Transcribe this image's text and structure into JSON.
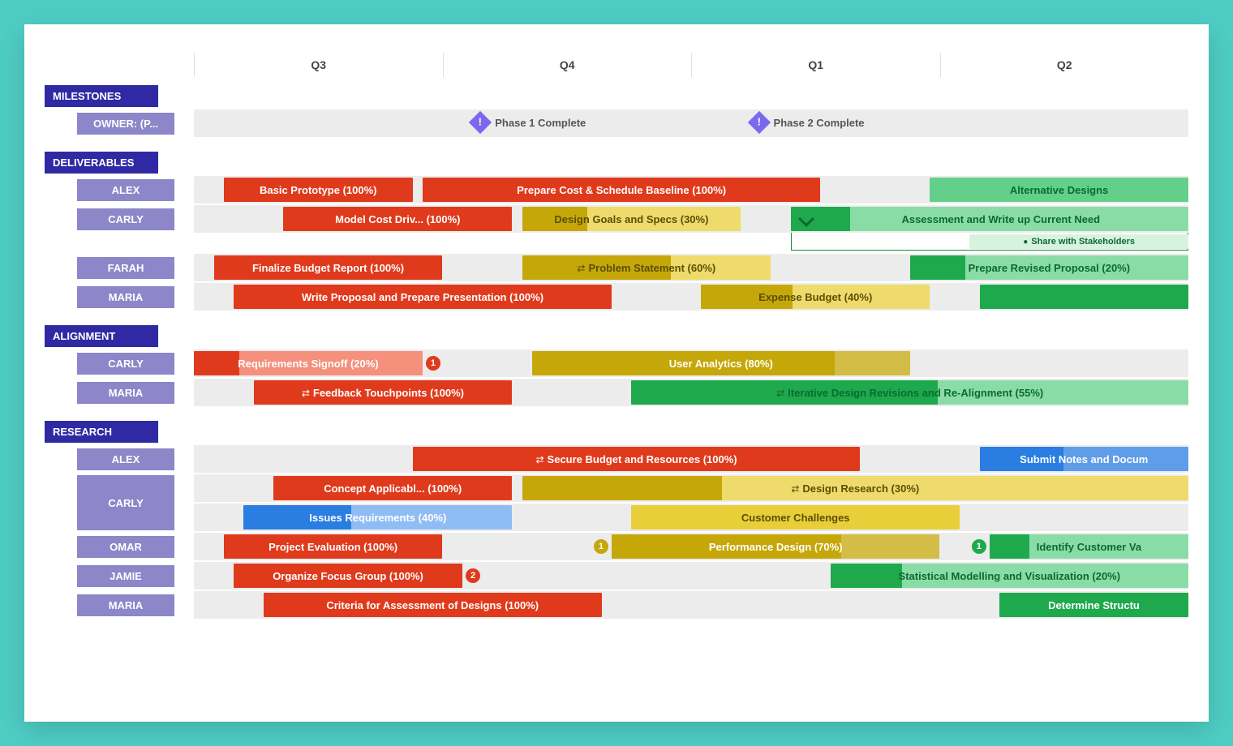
{
  "chart_data": {
    "type": "gantt",
    "time_axis": {
      "columns": [
        "Q3",
        "Q4",
        "Q1",
        "Q2"
      ],
      "unit": "quarter"
    },
    "colors": {
      "red": "#e03a1c",
      "red_light": "#f06b50",
      "olive": "#c5a709",
      "olive_light": "#e8cf3a",
      "green": "#1ea94c",
      "green_light": "#63d08a",
      "blue": "#2a7de1",
      "blue_light": "#6ba6f0",
      "section": "#2f2aa3",
      "owner": "#8d86c9",
      "milestone": "#7b68ee"
    },
    "sections": [
      {
        "name": "MILESTONES",
        "rows": [
          {
            "owner": "OWNER: (P...",
            "milestones": [
              {
                "label": "Phase 1 Complete",
                "pos": 28
              },
              {
                "label": "Phase 2 Complete",
                "pos": 56
              }
            ]
          }
        ]
      },
      {
        "name": "DELIVERABLES",
        "rows": [
          {
            "owner": "ALEX",
            "bars": [
              {
                "label": "Basic Prototype (100%)",
                "start": 3,
                "end": 22,
                "color": "red",
                "progress": 100
              },
              {
                "label": "Prepare Cost & Schedule Baseline (100%)",
                "start": 23,
                "end": 63,
                "color": "red",
                "progress": 100
              },
              {
                "label": "Alternative Designs",
                "start": 74,
                "end": 100,
                "color": "green_light",
                "text_color": "#0a6b2e",
                "progress": 0
              }
            ]
          },
          {
            "owner": "CARLY",
            "bars": [
              {
                "label": "Model Cost Driv... (100%)",
                "start": 9,
                "end": 32,
                "color": "red",
                "progress": 100
              },
              {
                "label": "Design Goals and Specs (30%)",
                "start": 33,
                "end": 55,
                "color": "olive_light",
                "progress": 30,
                "text_color": "#5c4f04"
              },
              {
                "label": "Assessment and Write up Current Need",
                "start": 60,
                "end": 100,
                "color": "green_light",
                "text_color": "#0a6b2e",
                "progress": 15,
                "expand": true,
                "subtasks": [
                  {
                    "label": "Share with Stakeholders",
                    "start": 78,
                    "end": 100
                  }
                ]
              }
            ]
          },
          {
            "owner": "FARAH",
            "bars": [
              {
                "label": "Finalize Budget Report (100%)",
                "start": 2,
                "end": 25,
                "color": "red",
                "progress": 100
              },
              {
                "label": "Problem Statement (60%)",
                "start": 33,
                "end": 58,
                "color": "olive_light",
                "text_color": "#5c4f04",
                "progress": 60,
                "icon": "subtask"
              },
              {
                "label": "Prepare Revised Proposal (20%)",
                "start": 72,
                "end": 100,
                "color": "green_light",
                "text_color": "#0a6b2e",
                "progress": 20
              }
            ]
          },
          {
            "owner": "MARIA",
            "bars": [
              {
                "label": "Write Proposal and Prepare Presentation (100%)",
                "start": 4,
                "end": 42,
                "color": "red",
                "progress": 100
              },
              {
                "label": "Expense Budget (40%)",
                "start": 51,
                "end": 74,
                "color": "olive_light",
                "text_color": "#5c4f04",
                "progress": 40
              },
              {
                "label": "",
                "start": 79,
                "end": 100,
                "color": "green",
                "progress": 100
              }
            ]
          }
        ]
      },
      {
        "name": "ALIGNMENT",
        "rows": [
          {
            "owner": "CARLY",
            "bars": [
              {
                "label": "Requirements Signoff (20%)",
                "start": 0,
                "end": 23,
                "color": "red_light",
                "progress": 20,
                "badge": {
                  "text": "1",
                  "color": "#e03a1c",
                  "side": "right"
                }
              },
              {
                "label": "User Analytics (80%)",
                "start": 34,
                "end": 72,
                "color": "olive",
                "text_color": "#fff",
                "progress": 80
              }
            ]
          },
          {
            "owner": "MARIA",
            "bars": [
              {
                "label": "Feedback Touchpoints (100%)",
                "start": 6,
                "end": 32,
                "color": "red",
                "progress": 100,
                "icon": "subtask"
              },
              {
                "label": "Iterative Design Revisions and Re-Alignment (55%)",
                "start": 44,
                "end": 100,
                "color": "green_light",
                "text_color": "#0a6b2e",
                "progress": 55,
                "icon": "subtask"
              }
            ]
          }
        ]
      },
      {
        "name": "RESEARCH",
        "rows": [
          {
            "owner": "ALEX",
            "bars": [
              {
                "label": "Secure Budget and Resources (100%)",
                "start": 22,
                "end": 67,
                "color": "red",
                "progress": 100,
                "icon": "subtask"
              },
              {
                "label": "Submit Notes and Docum",
                "start": 79,
                "end": 100,
                "color": "blue",
                "progress": 40
              }
            ]
          },
          {
            "owner": "CARLY",
            "double": true,
            "bars_a": [
              {
                "label": "Concept Applicabl... (100%)",
                "start": 8,
                "end": 32,
                "color": "red",
                "progress": 100
              },
              {
                "label": "Design Research (30%)",
                "start": 33,
                "end": 100,
                "color": "olive_light",
                "text_color": "#5c4f04",
                "progress": 30,
                "icon": "subtask"
              }
            ],
            "bars_b": [
              {
                "label": "Issues Requirements (40%)",
                "start": 5,
                "end": 32,
                "color": "blue_light",
                "progress": 40
              },
              {
                "label": "Customer Challenges",
                "start": 44,
                "end": 77,
                "color": "olive_light",
                "text_color": "#5c4f04",
                "progress": 0
              }
            ]
          },
          {
            "owner": "OMAR",
            "bars": [
              {
                "label": "Project Evaluation (100%)",
                "start": 3,
                "end": 25,
                "color": "red",
                "progress": 100
              },
              {
                "label": "Performance Design (70%)",
                "start": 42,
                "end": 75,
                "color": "olive",
                "text_color": "#fff",
                "progress": 70,
                "badge": {
                  "text": "1",
                  "color": "#c5a709",
                  "side": "left"
                }
              },
              {
                "label": "Identify Customer Va",
                "start": 80,
                "end": 100,
                "color": "green_light",
                "text_color": "#0a6b2e",
                "progress": 20,
                "badge": {
                  "text": "1",
                  "color": "#1ea94c",
                  "side": "left"
                }
              }
            ]
          },
          {
            "owner": "JAMIE",
            "bars": [
              {
                "label": "Organize Focus Group (100%)",
                "start": 4,
                "end": 27,
                "color": "red",
                "progress": 100,
                "badge": {
                  "text": "2",
                  "color": "#e03a1c",
                  "side": "right"
                }
              },
              {
                "label": "Statistical Modelling and Visualization (20%)",
                "start": 64,
                "end": 100,
                "color": "green_light",
                "text_color": "#0a6b2e",
                "progress": 20
              }
            ]
          },
          {
            "owner": "MARIA",
            "bars": [
              {
                "label": "Criteria for Assessment of Designs (100%)",
                "start": 7,
                "end": 41,
                "color": "red",
                "progress": 100
              },
              {
                "label": "Determine Structu",
                "start": 81,
                "end": 100,
                "color": "green",
                "progress": 100
              }
            ]
          }
        ]
      }
    ]
  }
}
